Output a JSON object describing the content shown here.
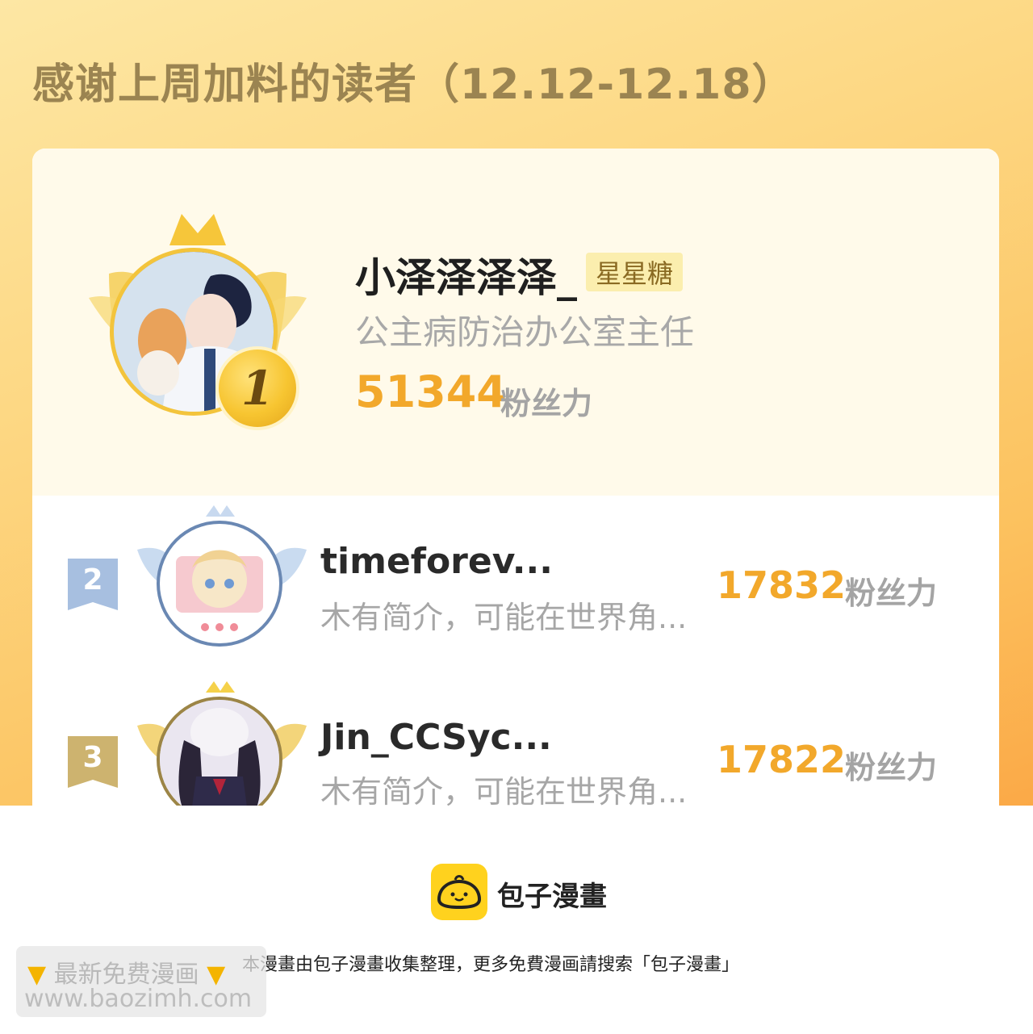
{
  "banner": {
    "title": "感谢上周加料的读者（12.12-12.18）"
  },
  "first_place": {
    "rank": "1",
    "name": "小泽泽泽泽_",
    "badge": "星星糖",
    "description": "公主病防治办公室主任",
    "score": "51344",
    "unit": "粉丝力"
  },
  "ranking": [
    {
      "rank": "2",
      "name": "timeforev...",
      "description": "木有简介，可能在世界角...",
      "score": "17832",
      "unit": "粉丝力"
    },
    {
      "rank": "3",
      "name": "Jin_CCSyc...",
      "description": "木有简介，可能在世界角...",
      "score": "17822",
      "unit": "粉丝力"
    }
  ],
  "footer": {
    "brand": "包子漫畫",
    "note": "本漫畫由包子漫畫收集整理，更多免費漫画請搜索「包子漫畫」"
  },
  "watermark": {
    "line1": "最新免费漫画",
    "line2": "www.baozimh.com"
  },
  "colors": {
    "accent": "#f2a82b",
    "banner": "#fdd884",
    "rank2": "#9fb6d6",
    "rank3": "#c9ae6b"
  }
}
